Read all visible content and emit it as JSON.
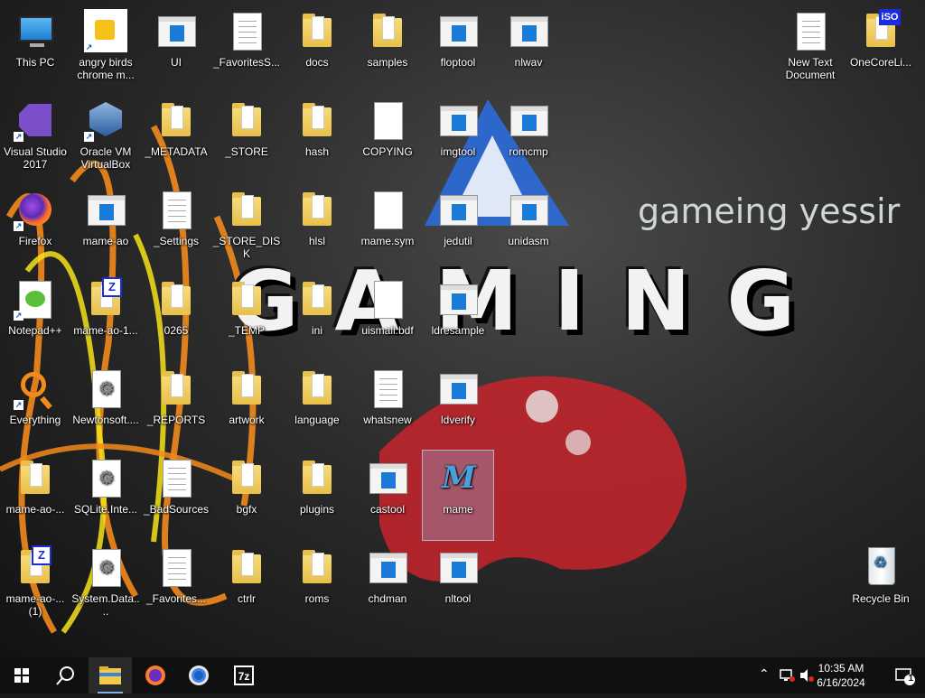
{
  "wallpaper": {
    "big_word": "GAMING",
    "tagline": "gameing yessir",
    "accent_blue": "#2b6cd8",
    "scribble_orange": "#f28a1c",
    "scribble_yellow": "#f6e21a",
    "controller_red": "#c8232c"
  },
  "desktop_icons": [
    {
      "label": "This PC",
      "kind": "this-pc"
    },
    {
      "label": "angry birds chrome m...",
      "kind": "shortcut-app"
    },
    {
      "label": "UI",
      "kind": "exe"
    },
    {
      "label": "_FavoritesS...",
      "kind": "doc"
    },
    {
      "label": "docs",
      "kind": "folder"
    },
    {
      "label": "samples",
      "kind": "folder"
    },
    {
      "label": "floptool",
      "kind": "exe"
    },
    {
      "label": "nlwav",
      "kind": "exe"
    },
    {
      "label": "New Text Document",
      "kind": "doc"
    },
    {
      "label": "OneCoreLi...",
      "kind": "iso-folder"
    },
    {
      "label": "Visual Studio 2017",
      "kind": "vs"
    },
    {
      "label": "Oracle VM VirtualBox",
      "kind": "vbox"
    },
    {
      "label": "_METADATA",
      "kind": "folder"
    },
    {
      "label": "_STORE",
      "kind": "folder"
    },
    {
      "label": "hash",
      "kind": "folder"
    },
    {
      "label": "COPYING",
      "kind": "blank"
    },
    {
      "label": "imgtool",
      "kind": "exe"
    },
    {
      "label": "romcmp",
      "kind": "exe"
    },
    {
      "label": "Firefox",
      "kind": "firefox"
    },
    {
      "label": "mame-ao",
      "kind": "exe"
    },
    {
      "label": "_Settings",
      "kind": "doc"
    },
    {
      "label": "_STORE_DISK",
      "kind": "folder"
    },
    {
      "label": "hlsl",
      "kind": "folder"
    },
    {
      "label": "mame.sym",
      "kind": "blank"
    },
    {
      "label": "jedutil",
      "kind": "exe"
    },
    {
      "label": "unidasm",
      "kind": "exe"
    },
    {
      "label": "Notepad++",
      "kind": "npp"
    },
    {
      "label": "mame-ao-1...",
      "kind": "zip-folder"
    },
    {
      "label": "0265",
      "kind": "folder"
    },
    {
      "label": "_TEMP",
      "kind": "folder"
    },
    {
      "label": "ini",
      "kind": "folder"
    },
    {
      "label": "uismall.bdf",
      "kind": "blank"
    },
    {
      "label": "ldresample",
      "kind": "exe"
    },
    {
      "label": "Everything",
      "kind": "everything"
    },
    {
      "label": "Newtonsoft....",
      "kind": "gear"
    },
    {
      "label": "_REPORTS",
      "kind": "folder"
    },
    {
      "label": "artwork",
      "kind": "folder"
    },
    {
      "label": "language",
      "kind": "folder"
    },
    {
      "label": "whatsnew",
      "kind": "doc"
    },
    {
      "label": "ldverify",
      "kind": "exe"
    },
    {
      "label": "mame-ao-...",
      "kind": "folder"
    },
    {
      "label": "SQLite.Inte...",
      "kind": "gear"
    },
    {
      "label": "_BadSources",
      "kind": "doc"
    },
    {
      "label": "bgfx",
      "kind": "folder"
    },
    {
      "label": "plugins",
      "kind": "folder"
    },
    {
      "label": "castool",
      "kind": "exe"
    },
    {
      "label": "mame",
      "kind": "mame"
    },
    {
      "label": "mame-ao-... (1)",
      "kind": "zip-folder"
    },
    {
      "label": "System.Data....",
      "kind": "gear"
    },
    {
      "label": "_Favorites...",
      "kind": "doc"
    },
    {
      "label": "ctrlr",
      "kind": "folder"
    },
    {
      "label": "roms",
      "kind": "folder"
    },
    {
      "label": "chdman",
      "kind": "exe"
    },
    {
      "label": "nltool",
      "kind": "exe"
    },
    {
      "label": "Recycle Bin",
      "kind": "recycle"
    }
  ],
  "selected_icon": "mame",
  "taskbar": {
    "start_icon": "windows-logo-icon",
    "search_icon": "search-icon",
    "pinned": [
      {
        "name": "file-explorer",
        "icon": "folder-icon",
        "active": true
      },
      {
        "name": "firefox",
        "icon": "firefox-icon",
        "active": false
      },
      {
        "name": "chrome",
        "icon": "chrome-icon",
        "active": false
      },
      {
        "name": "7-zip",
        "icon": "7z-icon",
        "active": false,
        "text": "7z"
      }
    ],
    "tray": {
      "chevron_icon": "chevron-up-icon",
      "network_icon": "network-icon",
      "volume_icon": "volume-muted-icon",
      "time": "10:35 AM",
      "date": "6/16/2024",
      "notification_count": "1"
    }
  }
}
